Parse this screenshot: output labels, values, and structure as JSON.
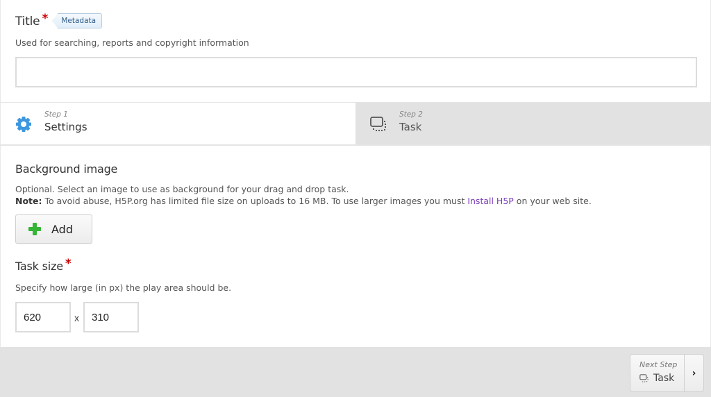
{
  "title_field": {
    "label": "Title",
    "required_marker": "*",
    "metadata_button": "Metadata",
    "description": "Used for searching, reports and copyright information",
    "value": "",
    "placeholder": ""
  },
  "tabs": [
    {
      "step": "Step 1",
      "label": "Settings",
      "icon": "gear-icon",
      "active": true
    },
    {
      "step": "Step 2",
      "label": "Task",
      "icon": "drag-drop-icon",
      "active": false
    }
  ],
  "background_image": {
    "label": "Background image",
    "description": "Optional. Select an image to use as background for your drag and drop task.",
    "note_label": "Note:",
    "note_text_before": " To avoid abuse, H5P.org has limited file size on uploads to 16 MB. To use larger images you must ",
    "note_link": "Install H5P",
    "note_text_after": " on your web site.",
    "add_button": "Add"
  },
  "task_size": {
    "label": "Task size",
    "required_marker": "*",
    "description": "Specify how large (in px) the play area should be.",
    "width": "620",
    "separator": "x",
    "height": "310"
  },
  "footer": {
    "next_step_label": "Next Step",
    "next_step_name": "Task",
    "arrow": "›"
  },
  "colors": {
    "accent_blue": "#3d97e0",
    "required_red": "#cc0000",
    "link_purple": "#7a3db8",
    "add_green": "#35b535"
  }
}
